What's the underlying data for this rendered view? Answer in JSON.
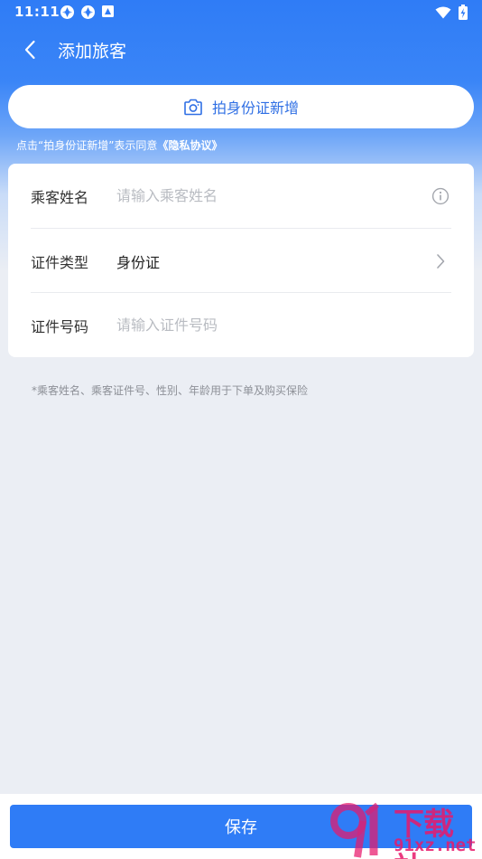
{
  "status_bar": {
    "time": "11:11"
  },
  "nav": {
    "title": "添加旅客"
  },
  "scan_button": {
    "label": "拍身份证新增"
  },
  "consent": {
    "prefix": "点击“拍身份证新增”表示同意",
    "link": "《隐私协议》"
  },
  "form": {
    "name": {
      "label": "乘客姓名",
      "placeholder": "请输入乘客姓名"
    },
    "id_type": {
      "label": "证件类型",
      "value": "身份证"
    },
    "id_number": {
      "label": "证件号码",
      "placeholder": "请输入证件号码"
    }
  },
  "note": "*乘客姓名、乘客证件号、性别、年龄用于下单及购买保险",
  "save_button": {
    "label": "保存"
  },
  "watermark": {
    "cn": "下载站",
    "en": "91xz.net"
  },
  "colors": {
    "primary": "#2f7cf6",
    "background": "#ebeef4",
    "watermark": "#e8196b"
  }
}
